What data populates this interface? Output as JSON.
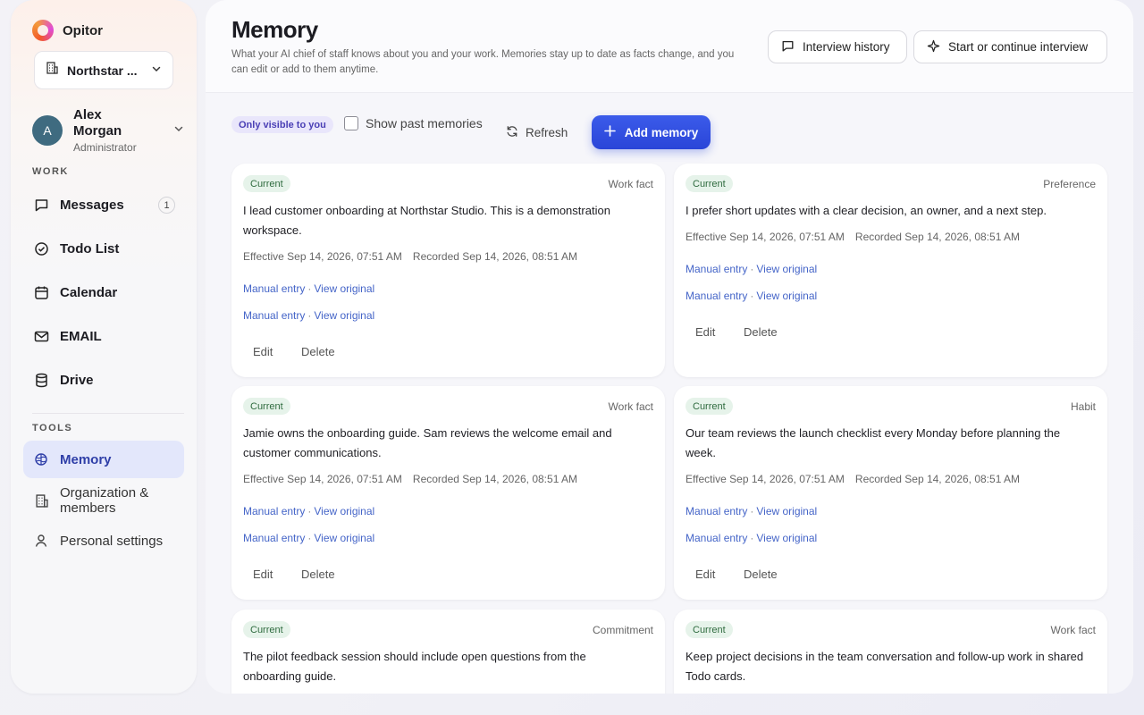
{
  "app": {
    "name": "Opitor"
  },
  "org_select": {
    "label": "Northstar ..."
  },
  "user": {
    "initial": "A",
    "name": "Alex Morgan",
    "role": "Administrator"
  },
  "sidebar": {
    "work_title": "WORK",
    "tools_title": "TOOLS",
    "work_items": [
      {
        "label": "Messages",
        "icon": "message-icon",
        "badge": "1"
      },
      {
        "label": "Todo List",
        "icon": "check-circle-icon"
      },
      {
        "label": "Calendar",
        "icon": "calendar-icon"
      },
      {
        "label": "EMAIL",
        "icon": "mail-icon"
      },
      {
        "label": "Drive",
        "icon": "database-icon"
      }
    ],
    "tool_items": [
      {
        "label": "Memory",
        "icon": "brain-icon",
        "active": true
      },
      {
        "label": "Organization & members",
        "icon": "building-icon"
      },
      {
        "label": "Personal settings",
        "icon": "person-icon"
      }
    ]
  },
  "header": {
    "title": "Memory",
    "description": "What your AI chief of staff knows about you and your work. Memories stay up to date as facts change, and you can edit or add to them anytime.",
    "interview_history": "Interview history",
    "start_interview": "Start or continue interview"
  },
  "toolbar": {
    "visibility": "Only visible to you",
    "show_past": "Show past memories",
    "refresh": "Refresh",
    "add": "Add memory"
  },
  "cards": [
    {
      "status": "Current",
      "category": "Work fact",
      "text": "I lead customer onboarding at Northstar Studio. This is a demonstration workspace.",
      "effective": "Effective Sep 14, 2026, 07:51 AM",
      "recorded": "Recorded Sep 14, 2026, 08:51 AM",
      "source": "Manual entry",
      "view": "View original",
      "edit": "Edit",
      "delete": "Delete"
    },
    {
      "status": "Current",
      "category": "Preference",
      "text": "I prefer short updates with a clear decision, an owner, and a next step.",
      "effective": "Effective Sep 14, 2026, 07:51 AM",
      "recorded": "Recorded Sep 14, 2026, 08:51 AM",
      "source": "Manual entry",
      "view": "View original",
      "edit": "Edit",
      "delete": "Delete"
    },
    {
      "status": "Current",
      "category": "Work fact",
      "text": "Jamie owns the onboarding guide. Sam reviews the welcome email and customer communications.",
      "effective": "Effective Sep 14, 2026, 07:51 AM",
      "recorded": "Recorded Sep 14, 2026, 08:51 AM",
      "source": "Manual entry",
      "view": "View original",
      "edit": "Edit",
      "delete": "Delete"
    },
    {
      "status": "Current",
      "category": "Habit",
      "text": "Our team reviews the launch checklist every Monday before planning the week.",
      "effective": "Effective Sep 14, 2026, 07:51 AM",
      "recorded": "Recorded Sep 14, 2026, 08:51 AM",
      "source": "Manual entry",
      "view": "View original",
      "edit": "Edit",
      "delete": "Delete"
    },
    {
      "status": "Current",
      "category": "Commitment",
      "text": "The pilot feedback session should include open questions from the onboarding guide."
    },
    {
      "status": "Current",
      "category": "Work fact",
      "text": "Keep project decisions in the team conversation and follow-up work in shared Todo cards."
    }
  ]
}
